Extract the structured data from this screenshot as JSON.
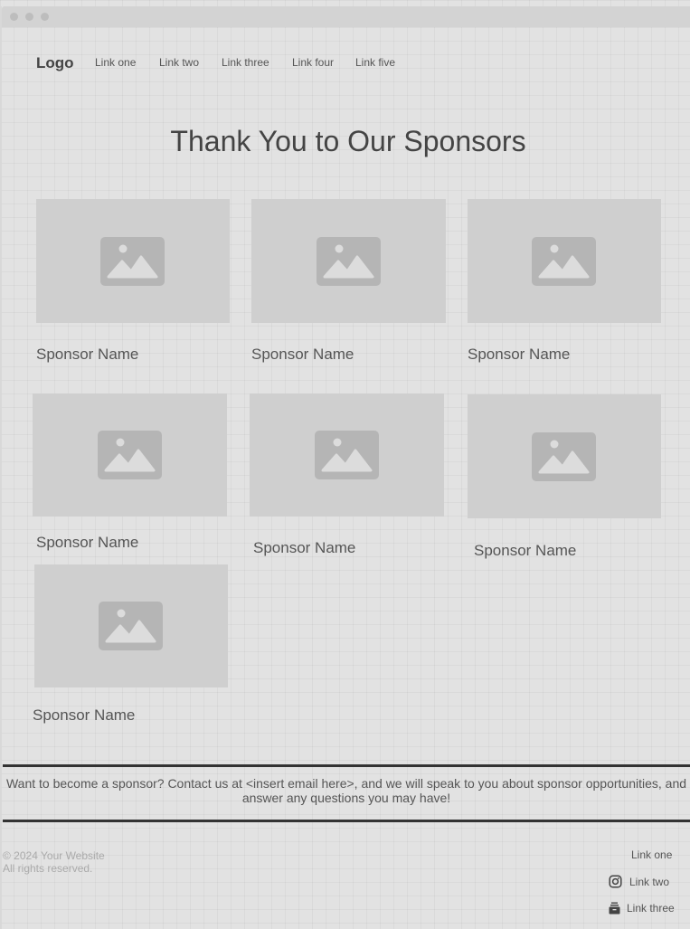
{
  "header": {
    "logo": "Logo",
    "nav": [
      "Link one",
      "Link two",
      "Link three",
      "Link four",
      "Link five"
    ]
  },
  "main": {
    "title": "Thank You to Our Sponsors",
    "sponsors": [
      {
        "name": "Sponsor Name",
        "image_icon": "image-placeholder-icon"
      },
      {
        "name": "Sponsor Name",
        "image_icon": "image-placeholder-icon"
      },
      {
        "name": "Sponsor Name",
        "image_icon": "image-placeholder-icon"
      },
      {
        "name": "Sponsor Name",
        "image_icon": "image-placeholder-icon"
      },
      {
        "name": "Sponsor Name",
        "image_icon": "image-placeholder-icon"
      },
      {
        "name": "Sponsor Name",
        "image_icon": "image-placeholder-icon"
      },
      {
        "name": "Sponsor Name",
        "image_icon": "image-placeholder-icon"
      }
    ]
  },
  "cta": {
    "text": "Want to become a sponsor? Contact us at <insert email here>, and we will speak to you about sponsor opportunities, and answer any questions you may have!"
  },
  "footer": {
    "copyright_line1": "© 2024 Your Website",
    "copyright_line2": "All rights reserved.",
    "links": [
      {
        "label": "Link one",
        "icon": ""
      },
      {
        "label": "Link two",
        "icon": "instagram-icon"
      },
      {
        "label": "Link three",
        "icon": "archive-box-icon"
      }
    ]
  },
  "colors": {
    "background": "#e2e2e2",
    "placeholder": "#cfcfcf",
    "placeholder_icon": "#b5b5b5",
    "text": "#444444",
    "divider": "#333333"
  }
}
